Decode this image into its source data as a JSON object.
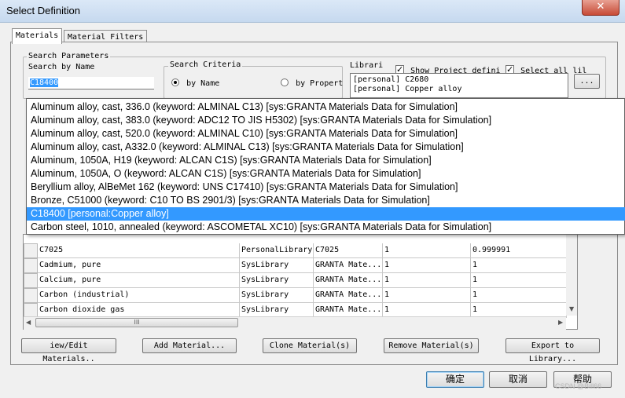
{
  "window": {
    "title": "Select Definition",
    "close_glyph": "✕"
  },
  "tabs": [
    {
      "label": "Materials"
    },
    {
      "label": "Material Filters"
    }
  ],
  "search_parameters": {
    "legend": "Search Parameters",
    "search_by_name_label": "Search by Name",
    "search_value": "C18400",
    "criteria": {
      "legend": "Search Criteria",
      "by_name": "by Name",
      "by_property": "by Propert"
    },
    "libraries": {
      "label": "Librari",
      "show_project": "Show Project defini",
      "select_all": "Select all lil",
      "items": [
        "[personal] C2680",
        "[personal] Copper alloy"
      ],
      "browse_button": "..."
    }
  },
  "dropdown": {
    "items": [
      "Aluminum alloy, cast, 336.0 (keyword: ALMINAL C13) [sys:GRANTA Materials Data for Simulation]",
      "Aluminum alloy, cast, 383.0 (keyword: ADC12 TO JIS H5302) [sys:GRANTA Materials Data for Simulation]",
      "Aluminum alloy, cast, 520.0 (keyword: ALMINAL C10) [sys:GRANTA Materials Data for Simulation]",
      "Aluminum alloy, cast, A332.0 (keyword: ALMINAL C13) [sys:GRANTA Materials Data for Simulation]",
      "Aluminum, 1050A, H19 (keyword: ALCAN C1S) [sys:GRANTA Materials Data for Simulation]",
      "Aluminum, 1050A, O (keyword: ALCAN C1S) [sys:GRANTA Materials Data for Simulation]",
      "Beryllium alloy, AlBeMet 162 (keyword: UNS C17410) [sys:GRANTA Materials Data for Simulation]",
      "Bronze, C51000 (keyword: C10 TO BS 2901/3) [sys:GRANTA Materials Data for Simulation]",
      "C18400 [personal:Copper alloy]",
      "Carbon steel, 1010, annealed (keyword: ASCOMETAL XC10) [sys:GRANTA Materials Data for Simulation]"
    ],
    "selected_index": 8
  },
  "materials_table": {
    "rows": [
      [
        "C7025",
        "PersonalLibrary",
        "C7025",
        "1",
        "0.999991"
      ],
      [
        "Cadmium, pure",
        "SysLibrary",
        "GRANTA Mate...",
        "1",
        "1"
      ],
      [
        "Calcium, pure",
        "SysLibrary",
        "GRANTA Mate...",
        "1",
        "1"
      ],
      [
        "Carbon (industrial)",
        "SysLibrary",
        "GRANTA Mate...",
        "1",
        "1"
      ],
      [
        "Carbon dioxide gas",
        "SysLibrary",
        "GRANTA Mate...",
        "1",
        "1"
      ]
    ],
    "hscroll_glyph": "III"
  },
  "actions": [
    "iew/Edit Materials..",
    "Add Material...",
    "Clone Material(s)",
    "Remove Material(s)",
    "Export to Library..."
  ],
  "dialog_buttons": {
    "ok": "确定",
    "cancel": "取消",
    "help": "帮助"
  },
  "watermark": "CSDN @Bill66",
  "colors": {
    "selection": "#3399ff",
    "close": "#c74a36"
  }
}
